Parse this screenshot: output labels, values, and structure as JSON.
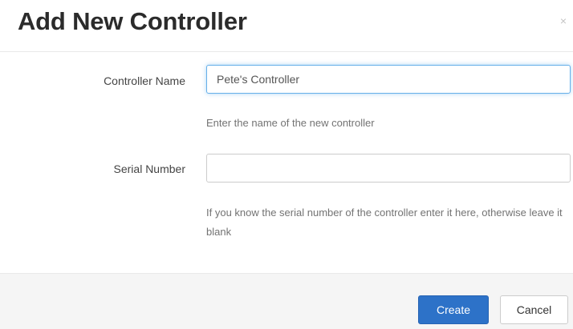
{
  "modal": {
    "title": "Add New Controller",
    "close_symbol": "×"
  },
  "form": {
    "controller_name": {
      "label": "Controller Name",
      "value": "Pete's Controller",
      "help": "Enter the name of the new controller"
    },
    "serial_number": {
      "label": "Serial Number",
      "value": "",
      "help": "If you know the serial number of the controller enter it here, otherwise leave it blank"
    }
  },
  "footer": {
    "create_label": "Create",
    "cancel_label": "Cancel"
  },
  "colors": {
    "primary": "#2d72c8",
    "focus_ring": "#66afe9",
    "footer_bg": "#f5f5f5"
  }
}
